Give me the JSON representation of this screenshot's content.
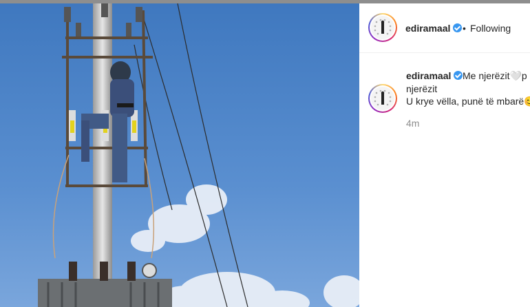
{
  "post": {
    "username": "ediramaal",
    "following_label": "Following",
    "separator": "•",
    "caption_line1": "Me njerëzit🤍p",
    "caption_line2": "njerëzit",
    "caption_line3": "U krye vëlla, punë të mbarë😊",
    "timestamp": "4m"
  },
  "icons": {
    "verified": "verified-badge-icon",
    "avatar": "profile-avatar"
  },
  "colors": {
    "sky": "#4f86c9",
    "verified": "#3897f0",
    "text": "#262626",
    "muted": "#8e8e8e"
  }
}
